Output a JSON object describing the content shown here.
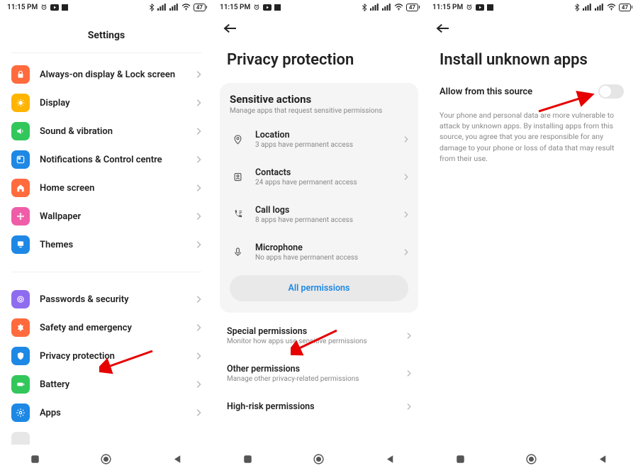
{
  "status": {
    "time": "11:15 PM",
    "battery": "47"
  },
  "p1": {
    "title": "Settings",
    "items": [
      {
        "label": "Always-on display & Lock screen",
        "color": "#ff6b3d"
      },
      {
        "label": "Display",
        "color": "#ffb400"
      },
      {
        "label": "Sound & vibration",
        "color": "#32c75a"
      },
      {
        "label": "Notifications & Control centre",
        "color": "#1e88e5"
      },
      {
        "label": "Home screen",
        "color": "#ff6b3d"
      },
      {
        "label": "Wallpaper",
        "color": "#ef5da8"
      },
      {
        "label": "Themes",
        "color": "#1e88e5"
      }
    ],
    "items2": [
      {
        "label": "Passwords & security",
        "color": "#8e6cef"
      },
      {
        "label": "Safety and emergency",
        "color": "#ff6b3d"
      },
      {
        "label": "Privacy protection",
        "color": "#1e88e5"
      },
      {
        "label": "Battery",
        "color": "#32c75a"
      },
      {
        "label": "Apps",
        "color": "#1e88e5"
      }
    ]
  },
  "p2": {
    "title": "Privacy protection",
    "card": {
      "title": "Sensitive actions",
      "sub": "Manage apps that request sensitive permissions",
      "rows": [
        {
          "t": "Location",
          "s": "3 apps have permanent access"
        },
        {
          "t": "Contacts",
          "s": "24 apps have permanent access"
        },
        {
          "t": "Call logs",
          "s": "8 apps have permanent access"
        },
        {
          "t": "Microphone",
          "s": "No apps have permanent access"
        }
      ],
      "all": "All permissions"
    },
    "below": [
      {
        "t": "Special permissions",
        "s": "Monitor how apps use sensitive permissions"
      },
      {
        "t": "Other permissions",
        "s": "Manage other privacy-related permissions"
      },
      {
        "t": "High-risk permissions",
        "s": ""
      }
    ]
  },
  "p3": {
    "title": "Install unknown apps",
    "toggle_label": "Allow from this source",
    "desc": "Your phone and personal data are more vulnerable to attack by unknown apps. By installing apps from this source, you agree that you are responsible for any damage to your phone or loss of data that may result from their use."
  }
}
